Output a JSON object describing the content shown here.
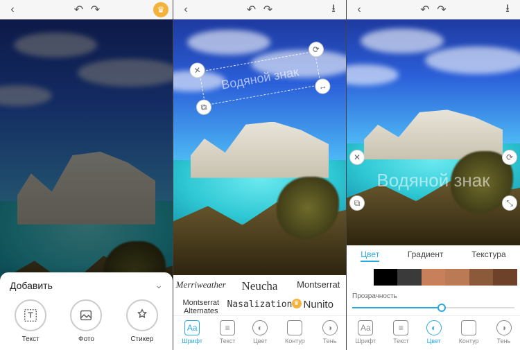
{
  "pane1": {
    "sheet_title": "Добавить",
    "buttons": [
      {
        "label": "Текст",
        "icon": "text-frame"
      },
      {
        "label": "Фото",
        "icon": "image"
      },
      {
        "label": "Стикер",
        "icon": "sticker"
      }
    ]
  },
  "pane2": {
    "watermark_text": "Водяной знак",
    "fonts": [
      "Merriweather",
      "Neucha",
      "Montserrat",
      "Montserrat Alternates",
      "Nasalization",
      "Nunito"
    ],
    "tabs": [
      {
        "label": "Шрифт",
        "active": true
      },
      {
        "label": "Текст",
        "active": false
      },
      {
        "label": "Цвет",
        "active": false
      },
      {
        "label": "Контур",
        "active": false
      },
      {
        "label": "Тень",
        "active": false
      }
    ]
  },
  "pane3": {
    "watermark_text": "Водяной знак",
    "color_tabs": [
      {
        "label": "Цвет",
        "active": true
      },
      {
        "label": "Градиент",
        "active": false
      },
      {
        "label": "Текстура",
        "active": false
      }
    ],
    "swatches": [
      "#ffffff",
      "#000000",
      "#3a3a3a",
      "#c8805a",
      "#b97a54",
      "#8a5a3a",
      "#6e4228"
    ],
    "opacity_label": "Прозрачность",
    "opacity_percent": 55,
    "tabs": [
      {
        "label": "Шрифт",
        "active": false
      },
      {
        "label": "Текст",
        "active": false
      },
      {
        "label": "Цвет",
        "active": true
      },
      {
        "label": "Контур",
        "active": false
      },
      {
        "label": "Тень",
        "active": false
      }
    ]
  }
}
